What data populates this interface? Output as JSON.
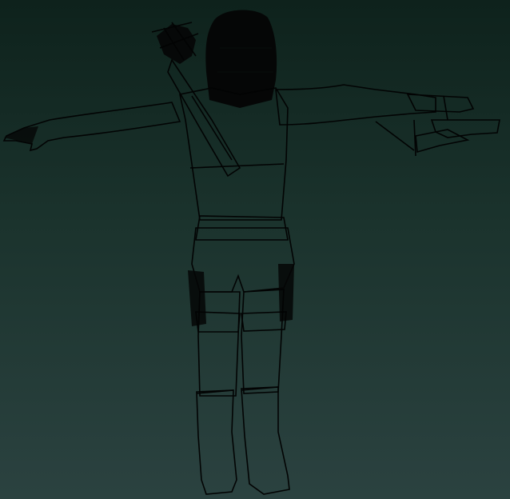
{
  "scene": {
    "subject": "wireframe-character-t-pose",
    "background_top": "#0e221c",
    "background_bottom": "#2b4240",
    "wire_color": "#050808"
  }
}
